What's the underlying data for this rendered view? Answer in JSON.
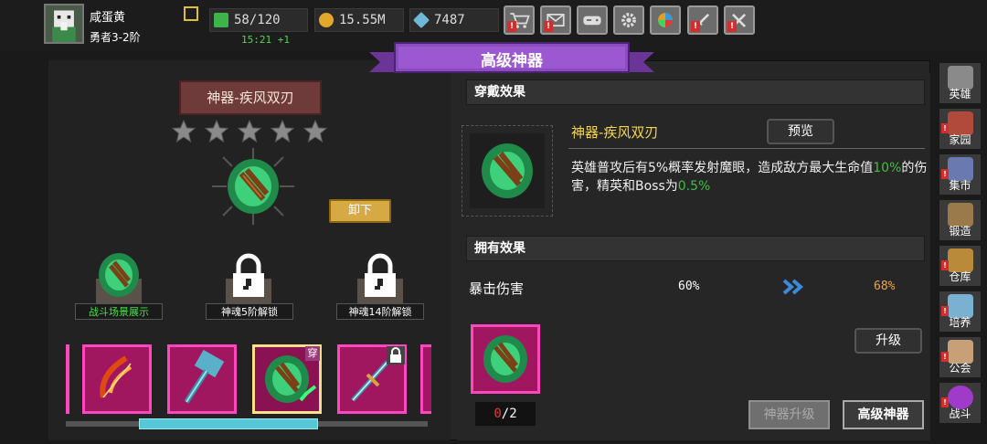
{
  "player": {
    "name": "咸蛋黄",
    "rank": "勇者3-2阶"
  },
  "resources": {
    "stamina": "58/120",
    "stamina_timer": "15:21 +1",
    "gold": "15.55M",
    "gems": "7487"
  },
  "toolbar": {
    "icons": [
      "shop-cart-icon",
      "mail-icon",
      "gamepad-icon",
      "settings-gear-icon",
      "color-wheel-icon",
      "sword-icon",
      "swords-icon"
    ]
  },
  "banner": {
    "title": "高级神器"
  },
  "artifact": {
    "name": "神器-疾风双刃",
    "stars": 5,
    "unload_label": "卸下"
  },
  "slots": [
    {
      "label": "战斗场景展示",
      "type": "unlocked"
    },
    {
      "label": "神魂5阶解锁",
      "type": "locked"
    },
    {
      "label": "神魂14阶解锁",
      "type": "locked"
    }
  ],
  "cards": [
    {
      "name": "fire-bow",
      "selected": false
    },
    {
      "name": "frost-hammer",
      "selected": false
    },
    {
      "name": "wind-blades",
      "selected": true,
      "badge": "穿"
    },
    {
      "name": "crystal-staff",
      "selected": false,
      "locked": true
    }
  ],
  "wear_effect": {
    "header": "穿戴效果",
    "name": "神器-疾风双刃",
    "preview_label": "预览",
    "desc_part1": "英雄普攻后有5%概率发射魔眼，造成敌方最大生命值",
    "desc_value1": "10%",
    "desc_part2": "的伤害，精英和Boss为",
    "desc_value2": "0.5%"
  },
  "owned_effect": {
    "header": "拥有效果",
    "stat_name": "暴击伤害",
    "current": "60%",
    "next": "68%"
  },
  "material": {
    "count_have": "0",
    "count_sep": "/2"
  },
  "buttons": {
    "upgrade": "升级",
    "artifact_upgrade": "神器升级",
    "advanced_artifact": "高级神器"
  },
  "sidenav": [
    {
      "label": "英雄",
      "icon": "helmet-icon",
      "alert": false
    },
    {
      "label": "家园",
      "icon": "castle-icon",
      "alert": true
    },
    {
      "label": "集市",
      "icon": "market-icon",
      "alert": true
    },
    {
      "label": "锻造",
      "icon": "anvil-icon",
      "alert": false
    },
    {
      "label": "仓库",
      "icon": "chest-icon",
      "alert": true
    },
    {
      "label": "培养",
      "icon": "potion-icon",
      "alert": true
    },
    {
      "label": "公会",
      "icon": "guild-icon",
      "alert": true
    },
    {
      "label": "战斗",
      "icon": "portal-icon",
      "alert": true
    }
  ],
  "colors": {
    "accent_purple": "#7b3fa8",
    "card_magenta": "#a0165f",
    "gold_text": "#f5d64a",
    "green_value": "#3fbf3f",
    "orange_value": "#f0a34a"
  }
}
